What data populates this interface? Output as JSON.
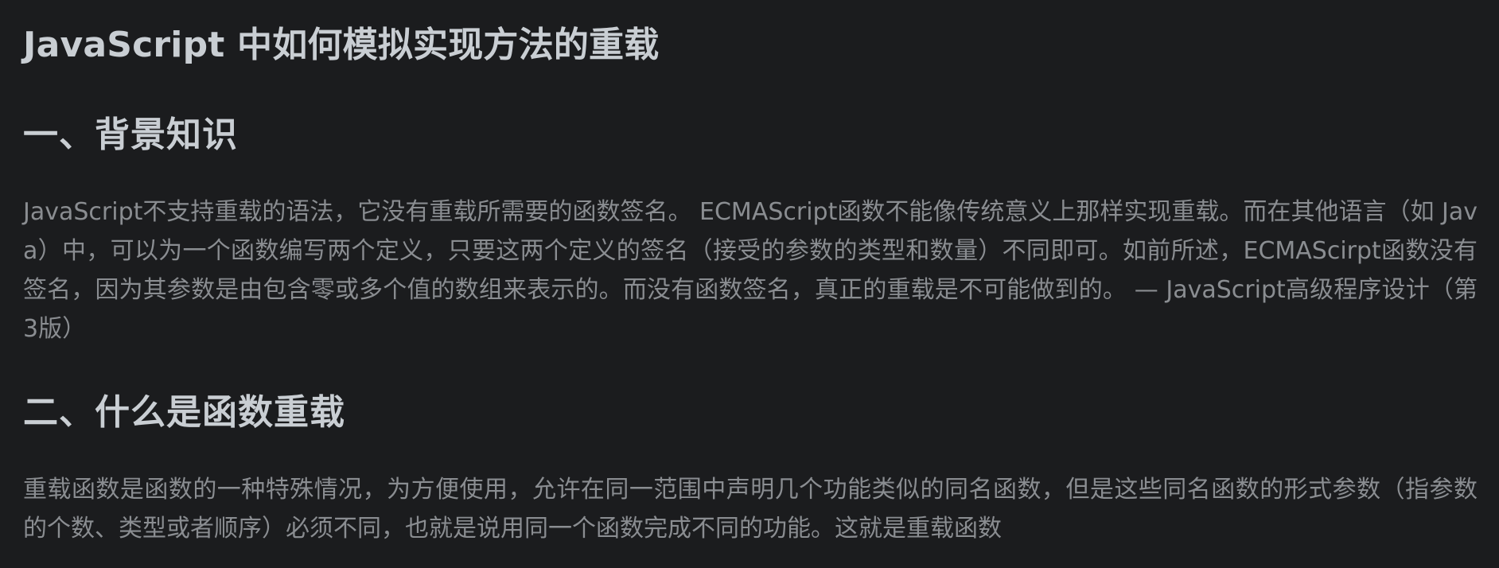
{
  "article": {
    "title": "JavaScript 中如何模拟实现方法的重载",
    "sections": [
      {
        "heading": "一、背景知识",
        "paragraph": "JavaScript不支持重载的语法，它没有重载所需要的函数签名。 ECMAScript函数不能像传统意义上那样实现重载。而在其他语言（如 Java）中，可以为一个函数编写两个定义，只要这两个定义的签名（接受的参数的类型和数量）不同即可。如前所述，ECMAScirpt函数没有签名，因为其参数是由包含零或多个值的数组来表示的。而没有函数签名，真正的重载是不可能做到的。 — JavaScript高级程序设计（第3版）"
      },
      {
        "heading": "二、什么是函数重载",
        "paragraph": "重载函数是函数的一种特殊情况，为方便使用，允许在同一范围中声明几个功能类似的同名函数，但是这些同名函数的形式参数（指参数的个数、类型或者顺序）必须不同，也就是说用同一个函数完成不同的功能。这就是重载函数"
      }
    ]
  },
  "colors": {
    "background": "#1b1c1e",
    "heading": "#c9ced3",
    "body_text": "#8a8d91"
  }
}
